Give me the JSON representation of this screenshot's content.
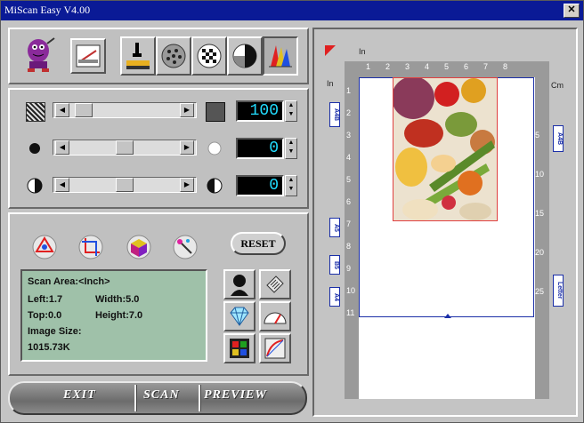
{
  "window": {
    "title": "MiScan Easy V4.00",
    "close_label": "✕"
  },
  "toolbar": {
    "icons": [
      "mascot-icon",
      "scanner-icon",
      "highlight-shadow-icon",
      "halftone-icon",
      "dither-icon",
      "contrast-icon",
      "color-icon"
    ]
  },
  "adjust": {
    "rows": [
      {
        "name": "resolution",
        "value": "100",
        "thumb_fraction": 0.1
      },
      {
        "name": "brightness",
        "value": "0",
        "thumb_fraction": 0.5
      },
      {
        "name": "contrast",
        "value": "0",
        "thumb_fraction": 0.5
      }
    ]
  },
  "tools": {
    "reset_label": "RESET"
  },
  "info": {
    "scan_area": "Scan Area:<Inch>",
    "left": "Left:1.7",
    "width": "Width:5.0",
    "top": "Top:0.0",
    "height": "Height:7.0",
    "image_size_label": "Image Size:",
    "image_size": "1015.73K"
  },
  "bottom": {
    "exit": "EXIT",
    "scan": "SCAN",
    "preview": "PREVIEW"
  },
  "ruler": {
    "top_unit": "In",
    "left_unit": "In",
    "right_unit": "Cm",
    "top_ticks": [
      "1",
      "2",
      "3",
      "4",
      "5",
      "6",
      "7",
      "8"
    ],
    "left_ticks": [
      "1",
      "2",
      "3",
      "4",
      "5",
      "6",
      "7",
      "8",
      "9",
      "10",
      "11"
    ],
    "right_ticks": [
      "5",
      "10",
      "15",
      "20",
      "25"
    ],
    "left_tabs": [
      "A4B",
      "A5",
      "B5",
      "A4"
    ],
    "right_tabs": [
      "A4B",
      "Letter"
    ]
  },
  "colors": {
    "titlebar": "#0a1a96",
    "lcd_text": "#22ddff",
    "info_bg": "#9fc1a9",
    "selection": "#1b2fa8",
    "crop": "#e04040"
  }
}
